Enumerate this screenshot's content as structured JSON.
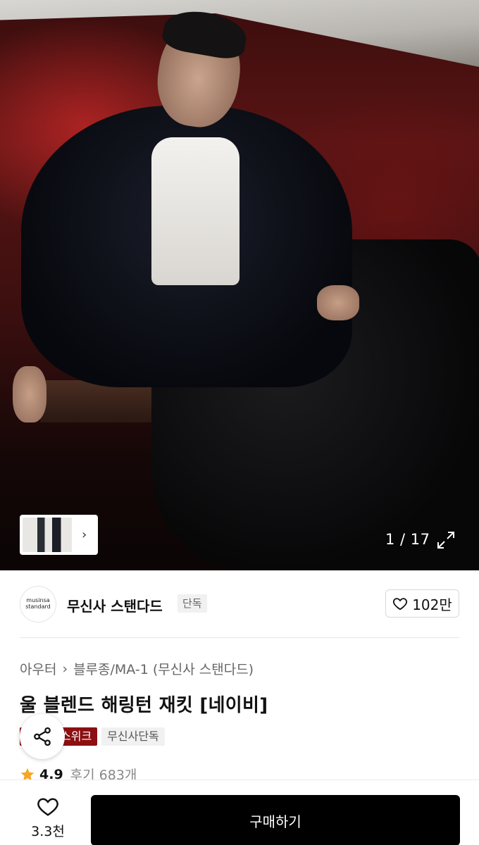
{
  "gallery": {
    "current": "1",
    "separator": "/",
    "total": "17",
    "counter_text": "1 / 17"
  },
  "brand": {
    "logo_line1": "musinsa",
    "logo_line2": "standard",
    "name": "무신사 스탠다드",
    "badge": "단독",
    "likes": "102만"
  },
  "product": {
    "breadcrumb": [
      "아우터",
      "블루종/MA-1 (무신사 스탠다드)"
    ],
    "title": "울 블렌드 해링턴 재킷 [네이비]",
    "tags": [
      {
        "label": "스위크",
        "style": "red"
      },
      {
        "label": "무신사단독",
        "style": "gray"
      }
    ],
    "rating": "4.9",
    "reviews": "후기 683개"
  },
  "bottom_bar": {
    "wish_count": "3.3천",
    "buy_label": "구매하기"
  },
  "colors": {
    "tag_red": "#8c0f12",
    "star": "#f6a623",
    "buy_button": "#000000"
  },
  "icons": [
    "chevron-right-icon",
    "expand-icon",
    "heart-icon",
    "share-icon",
    "star-icon"
  ]
}
